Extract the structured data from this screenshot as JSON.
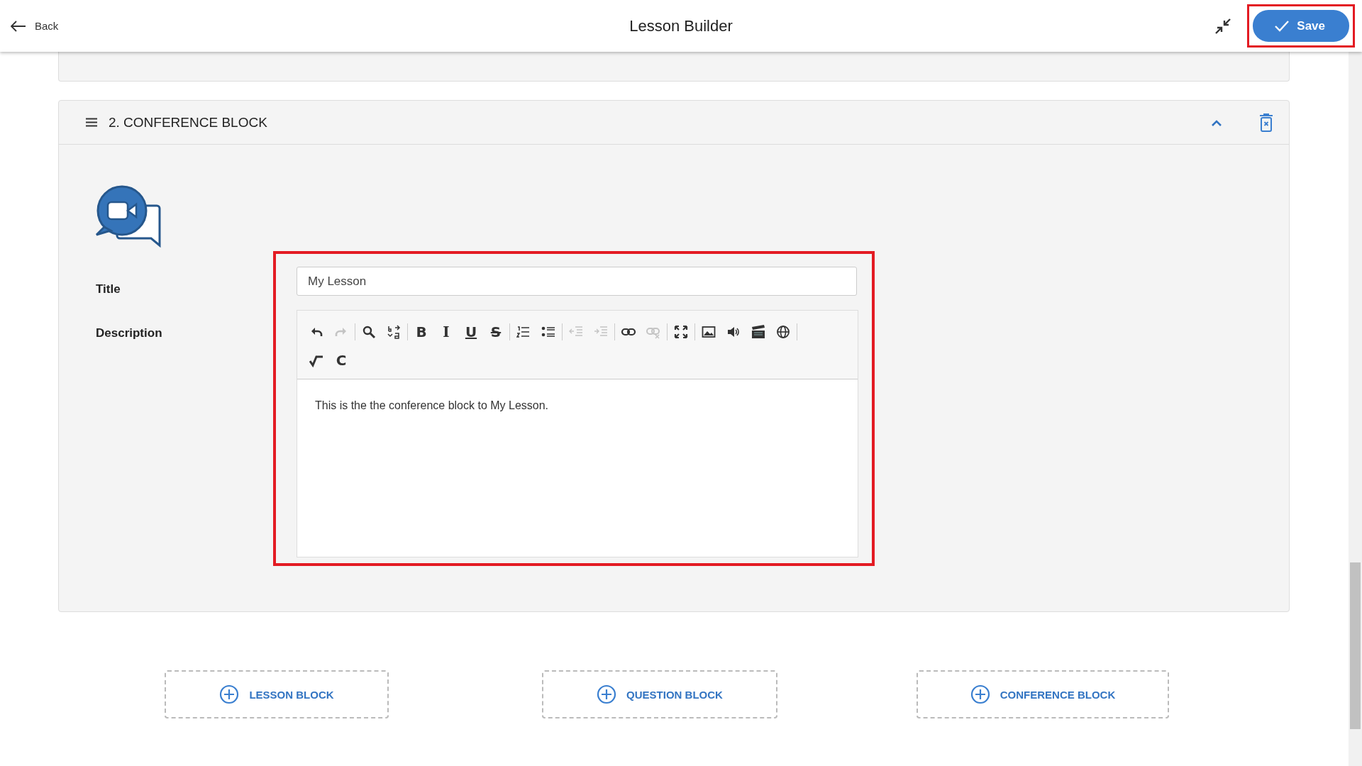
{
  "header": {
    "back_label": "Back",
    "title": "Lesson Builder",
    "save_label": "Save",
    "save_highlighted": true
  },
  "block": {
    "heading": "2. CONFERENCE BLOCK",
    "expanded": true,
    "title_label": "Title",
    "title_value": "My Lesson",
    "description_label": "Description",
    "editor_highlighted": true,
    "toolbar_rows": [
      [
        [
          {
            "kind": "undo",
            "disabled": false
          },
          {
            "kind": "redo",
            "disabled": true
          }
        ],
        [
          {
            "kind": "search",
            "disabled": false
          },
          {
            "kind": "replace",
            "disabled": false
          }
        ],
        [
          {
            "kind": "bold",
            "glyph": "B",
            "disabled": false
          },
          {
            "kind": "italic",
            "glyph": "I",
            "disabled": false
          },
          {
            "kind": "underline",
            "glyph": "U",
            "disabled": false
          },
          {
            "kind": "strike",
            "glyph": "S",
            "disabled": false
          }
        ],
        [
          {
            "kind": "ordered-list",
            "disabled": false
          },
          {
            "kind": "bullet-list",
            "disabled": false
          }
        ],
        [
          {
            "kind": "outdent",
            "disabled": true
          },
          {
            "kind": "indent",
            "disabled": true
          }
        ],
        [
          {
            "kind": "link",
            "disabled": false
          },
          {
            "kind": "unlink",
            "disabled": true
          }
        ],
        [
          {
            "kind": "fullscreen",
            "disabled": false
          }
        ],
        [
          {
            "kind": "image",
            "disabled": false
          },
          {
            "kind": "audio",
            "disabled": false
          },
          {
            "kind": "video",
            "disabled": false
          },
          {
            "kind": "globe",
            "disabled": false
          }
        ]
      ],
      [
        [
          {
            "kind": "sqrt",
            "disabled": false
          },
          {
            "kind": "letter",
            "glyph": "C",
            "disabled": false
          }
        ]
      ]
    ],
    "description_text": "This is the the conference block to My Lesson."
  },
  "add_buttons": [
    {
      "label": "LESSON BLOCK"
    },
    {
      "label": "QUESTION BLOCK"
    },
    {
      "label": "CONFERENCE BLOCK"
    }
  ]
}
